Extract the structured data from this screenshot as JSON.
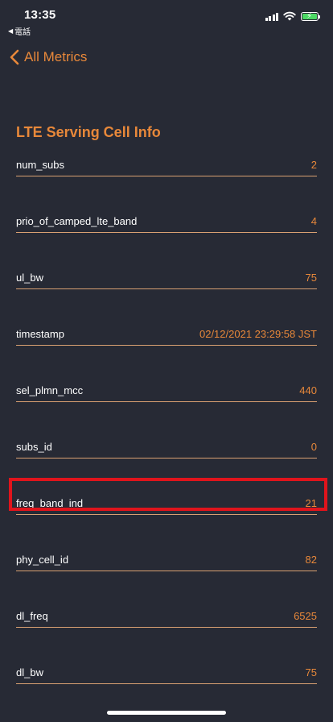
{
  "status_bar": {
    "time": "13:35",
    "back_app_label": "電話"
  },
  "nav": {
    "back_label": "All Metrics"
  },
  "section": {
    "title": "LTE Serving Cell Info"
  },
  "metrics": [
    {
      "key": "num_subs",
      "value": "2"
    },
    {
      "key": "prio_of_camped_lte_band",
      "value": "4"
    },
    {
      "key": "ul_bw",
      "value": "75"
    },
    {
      "key": "timestamp",
      "value": "02/12/2021 23:29:58 JST"
    },
    {
      "key": "sel_plmn_mcc",
      "value": "440"
    },
    {
      "key": "subs_id",
      "value": "0"
    },
    {
      "key": "freq_band_ind",
      "value": "21"
    },
    {
      "key": "phy_cell_id",
      "value": "82"
    },
    {
      "key": "dl_freq",
      "value": "6525"
    },
    {
      "key": "dl_bw",
      "value": "75"
    }
  ],
  "colors": {
    "background": "#272a35",
    "accent": "#e8883a",
    "highlight": "#e0141c",
    "battery": "#4cd964"
  }
}
